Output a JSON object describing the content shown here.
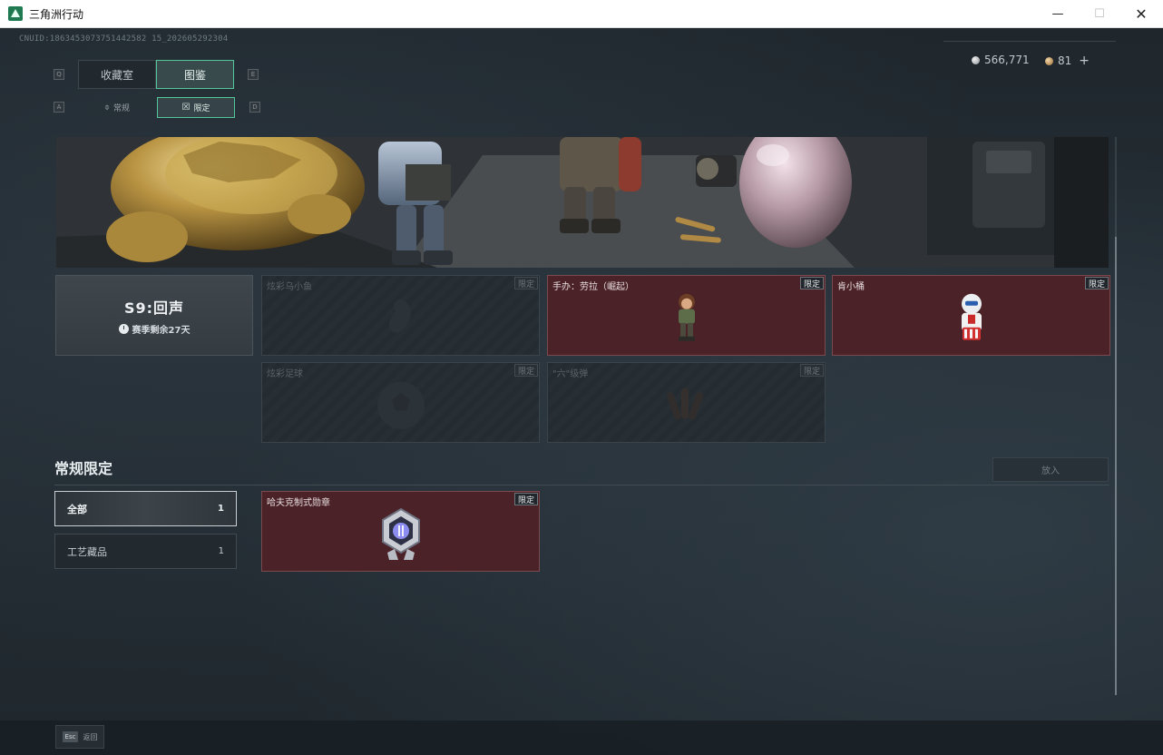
{
  "window": {
    "title": "三角洲行动",
    "minimize_glyph": "—",
    "maximize_glyph": "☐",
    "close_glyph": "✕"
  },
  "uid": "CNUID:1863453073751442582 15_202605292304",
  "currency": {
    "silver": "566,771",
    "bronze": "81",
    "add_glyph": "+"
  },
  "keyhints": {
    "left_tab": "Q",
    "right_tab": "E",
    "left_sub": "A",
    "right_sub": "D"
  },
  "tabs": [
    {
      "label": "收藏室",
      "active": false
    },
    {
      "label": "图鉴",
      "active": true
    }
  ],
  "subtabs": [
    {
      "label": "常规",
      "icon": "bottle-icon",
      "glyph": "⌽",
      "active": false
    },
    {
      "label": "限定",
      "icon": "mask-icon",
      "glyph": "☒",
      "active": true
    }
  ],
  "season": {
    "title": "S9:回声",
    "remaining": "赛季剩余27天"
  },
  "season_items": [
    {
      "name": "炫彩乌小鱼",
      "badge": "限定",
      "owned": false
    },
    {
      "name": "手办：劳拉（崛起）",
      "badge": "限定",
      "owned": true
    },
    {
      "name": "肯小桶",
      "badge": "限定",
      "owned": true
    },
    {
      "name": "炫彩足球",
      "badge": "限定",
      "owned": false
    },
    {
      "name": "\"六\"级弹",
      "badge": "限定",
      "owned": false
    }
  ],
  "regular": {
    "title": "常规限定",
    "import_label": "放入",
    "filters": [
      {
        "label": "全部",
        "count": "1",
        "active": true
      },
      {
        "label": "工艺藏品",
        "count": "1",
        "active": false
      }
    ],
    "items": [
      {
        "name": "哈夫克制式勋章",
        "badge": "限定",
        "owned": true
      }
    ]
  },
  "footer": {
    "esc_key": "Esc",
    "esc_label": "返回"
  },
  "colors": {
    "accent_green": "#54c79a",
    "owned_card": "#4a2227",
    "background": "#1c2329"
  }
}
